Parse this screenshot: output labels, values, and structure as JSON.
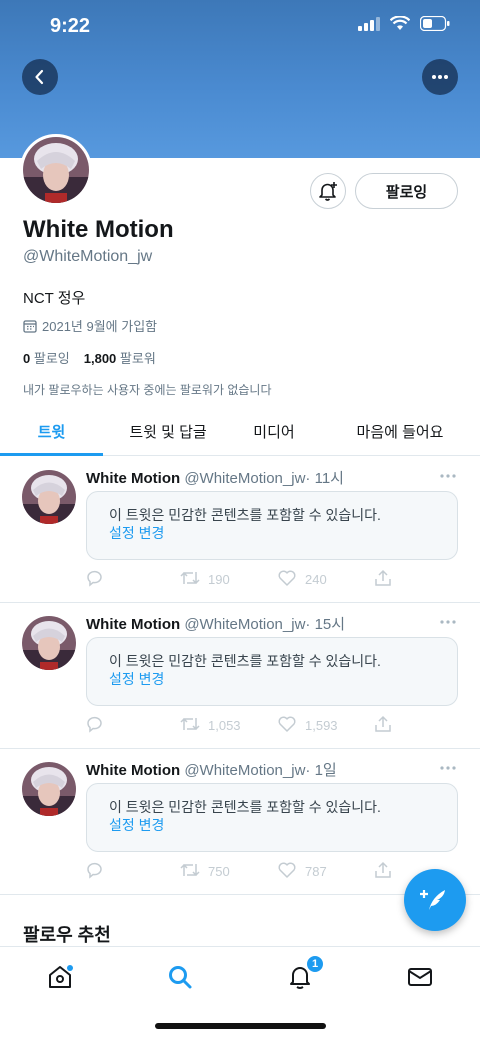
{
  "status_bar": {
    "time": "9:22"
  },
  "profile": {
    "name": "White Motion",
    "handle": "@WhiteMotion_jw",
    "bio": "NCT 정우",
    "joined": "2021년 9월에 가입함",
    "following_count": "0",
    "following_label": "팔로잉",
    "followers_count": "1,800",
    "followers_label": "팔로워",
    "mutual_note": "내가 팔로우하는 사용자 중에는 팔로워가 없습니다",
    "following_button": "팔로잉"
  },
  "tabs": [
    {
      "label": "트윗",
      "active": true
    },
    {
      "label": "트윗 및 답글",
      "active": false
    },
    {
      "label": "미디어",
      "active": false
    },
    {
      "label": "마음에 들어요",
      "active": false
    }
  ],
  "tweets": [
    {
      "name": "White Motion",
      "handle": "@WhiteMotion_jw",
      "time": "· 11시",
      "notice": "이 트윗은 민감한 콘텐츠를 포함할 수 있습니다.",
      "link": "설정 변경",
      "retweets": "190",
      "likes": "240"
    },
    {
      "name": "White Motion",
      "handle": "@WhiteMotion_jw",
      "time": "· 15시",
      "notice": "이 트윗은 민감한 콘텐츠를 포함할 수 있습니다.",
      "link": "설정 변경",
      "retweets": "1,053",
      "likes": "1,593"
    },
    {
      "name": "White Motion",
      "handle": "@WhiteMotion_jw",
      "time": "· 1일",
      "notice": "이 트윗은 민감한 콘텐츠를 포함할 수 있습니다.",
      "link": "설정 변경",
      "retweets": "750",
      "likes": "787"
    }
  ],
  "follow_suggestions_title": "팔로우 추천",
  "bottom_nav": {
    "items": [
      "home-icon",
      "search-icon",
      "notifications-icon",
      "messages-icon"
    ],
    "active": "search-icon",
    "notification_badge": "1"
  },
  "colors": {
    "accent": "#1d9bf0",
    "banner": "#4a8ad0",
    "muted": "#657786"
  }
}
